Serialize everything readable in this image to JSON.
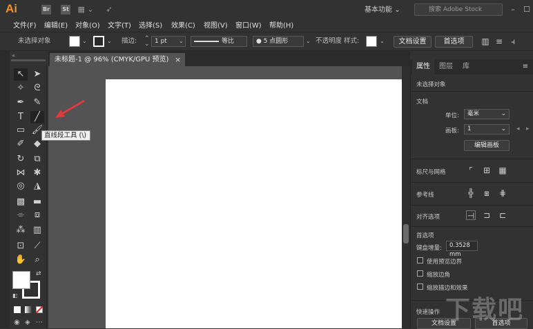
{
  "app": {
    "logo": "Ai",
    "workspace": "基本功能",
    "stock_search_placeholder": "搜索 Adobe Stock"
  },
  "topbar_icons": {
    "br": "Br",
    "st": "St"
  },
  "menus": [
    "文件(F)",
    "编辑(E)",
    "对象(O)",
    "文字(T)",
    "选择(S)",
    "效果(C)",
    "视图(V)",
    "窗口(W)",
    "帮助(H)"
  ],
  "control": {
    "no_selection": "未选择对象",
    "stroke_label": "描边:",
    "stroke_weight": "1 pt",
    "stroke_style": "等比",
    "brush": "5 点圆形",
    "opacity_label": "不透明度",
    "style_label": "样式:",
    "doc_setup": "文档设置",
    "preferences": "首选项"
  },
  "document": {
    "tab_title": "未标题-1 @ 96% (CMYK/GPU 预览)",
    "close": "×"
  },
  "tooltip": "直线段工具 (\\)",
  "panel": {
    "tabs": [
      "属性",
      "图层",
      "库"
    ],
    "no_selection": "未选择对象",
    "doc_section": "文档",
    "units_label": "单位:",
    "units_value": "毫米",
    "artboard_label": "画板:",
    "artboard_value": "1",
    "edit_artboards": "编辑画板",
    "rulers_grids": "标尺与网格",
    "guides": "参考线",
    "align_options": "对齐选项",
    "preferences_section": "首选项",
    "keyboard_increment_label": "键盘增量:",
    "keyboard_increment_value": "0.3528 mm",
    "check_preview_bounds": "使用预览边界",
    "check_scale_corners": "缩放边角",
    "check_scale_strokes": "缩放描边和效果",
    "quick_actions": "快速操作",
    "quick_doc_setup": "文档设置",
    "quick_preferences": "首选项"
  },
  "watermark": "下载吧",
  "colors": {
    "accent": "#f7931e",
    "canvas_bg": "#535353",
    "ui_bg": "#323232",
    "artboard": "#ffffff",
    "annotation_arrow": "#e03a3a"
  }
}
